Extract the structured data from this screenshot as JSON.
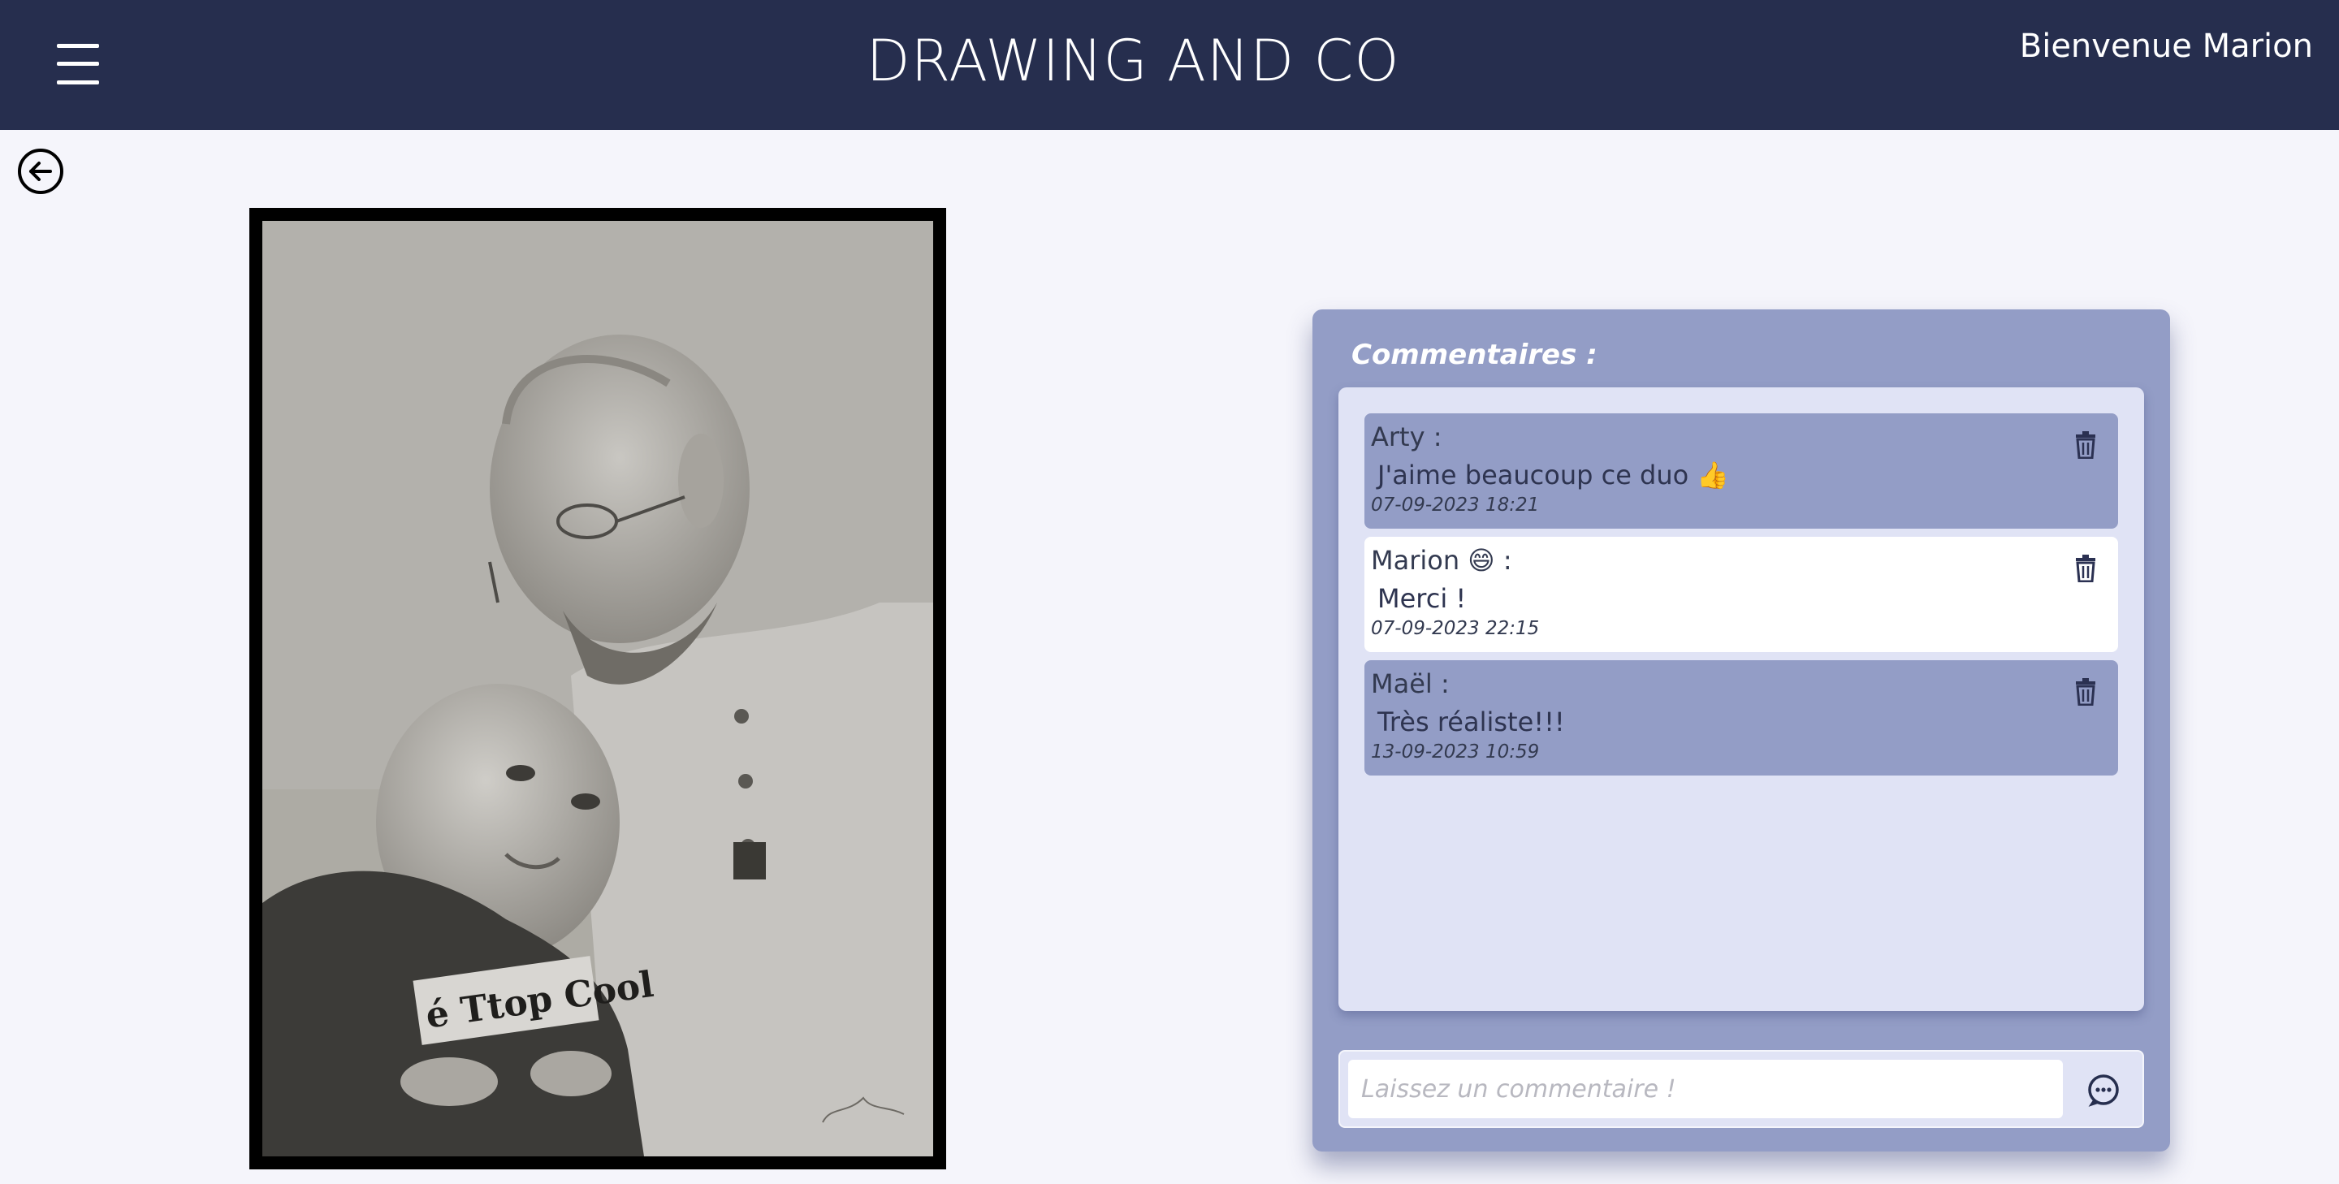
{
  "header": {
    "title": "DRAWING AND CO",
    "welcome": "Bienvenue Marion"
  },
  "artwork": {
    "shirt_text": "é Ttop Cool"
  },
  "comments_panel": {
    "title": "Commentaires :",
    "comments": [
      {
        "author": "Arty :",
        "text": "J'aime beaucoup ce duo 👍",
        "date": "07-09-2023 18:21",
        "style": "blue"
      },
      {
        "author": "Marion 😄 :",
        "text": "Merci !",
        "date": "07-09-2023 22:15",
        "style": "white"
      },
      {
        "author": "Maël :",
        "text": "Très réaliste!!!",
        "date": "13-09-2023 10:59",
        "style": "blue"
      }
    ],
    "input_placeholder": "Laissez un commentaire !"
  },
  "colors": {
    "header_bg": "#262e4e",
    "panel_bg": "#939dc6",
    "comment_box_bg": "#e0e3f5",
    "page_bg": "#f5f5fb"
  },
  "icons": {
    "menu": "hamburger-menu-icon",
    "back": "arrow-left-circle-icon",
    "delete": "trash-icon",
    "send": "chat-bubble-icon"
  }
}
